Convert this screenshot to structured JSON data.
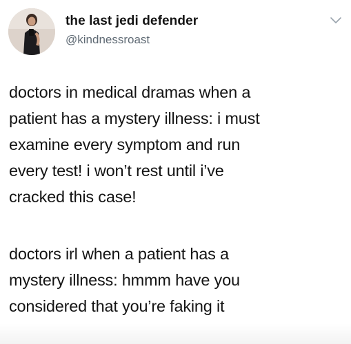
{
  "tweet": {
    "author_name": "the last jedi defender",
    "author_handle": "@kindnessroast",
    "paragraphs": [
      {
        "lines": [
          "doctors in medical dramas when a",
          "patient has a mystery illness: i must",
          "examine every symptom and run",
          "every test! i won’t rest until i’ve",
          "cracked this case!"
        ]
      },
      {
        "lines": [
          "doctors irl when a patient has a",
          "mystery illness: hmmm have you",
          "considered that you’re faking it"
        ]
      }
    ]
  },
  "icons": {
    "avatar": "avatar-photo",
    "menu": "chevron-down-icon"
  }
}
